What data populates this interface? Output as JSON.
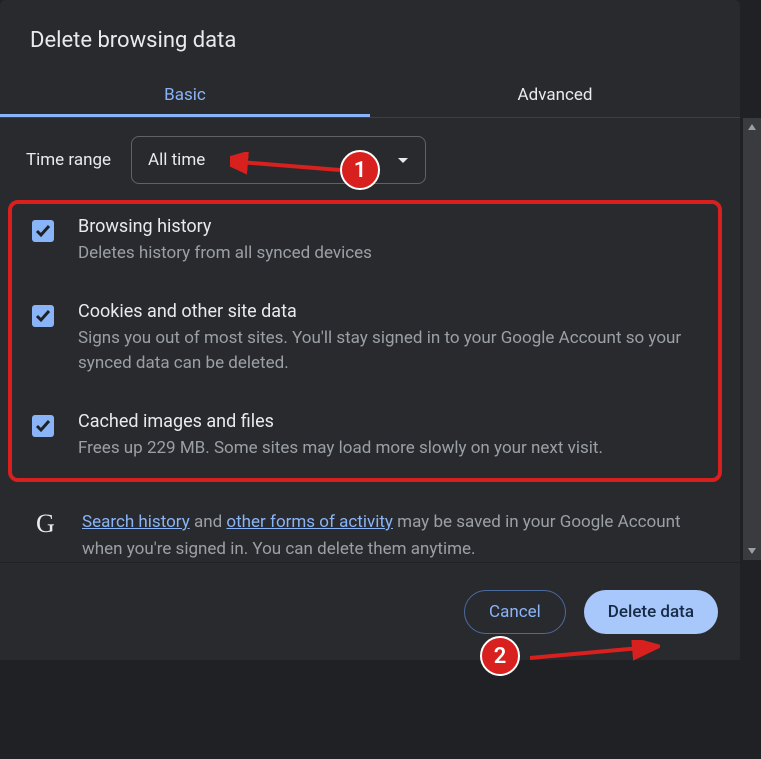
{
  "dialog": {
    "title": "Delete browsing data",
    "tabs": {
      "basic": "Basic",
      "advanced": "Advanced"
    },
    "time": {
      "label": "Time range",
      "value": "All time"
    },
    "options": [
      {
        "title": "Browsing history",
        "desc": "Deletes history from all synced devices"
      },
      {
        "title": "Cookies and other site data",
        "desc": "Signs you out of most sites. You'll stay signed in to your Google Account so your synced data can be deleted."
      },
      {
        "title": "Cached images and files",
        "desc": "Frees up 229 MB. Some sites may load more slowly on your next visit."
      }
    ],
    "google": {
      "link1": "Search history",
      "mid1": " and ",
      "link2": "other forms of activity",
      "rest": " may be saved in your Google Account when you're signed in. You can delete them anytime."
    },
    "buttons": {
      "cancel": "Cancel",
      "confirm": "Delete data"
    }
  },
  "annotations": {
    "marker1": "1",
    "marker2": "2"
  }
}
